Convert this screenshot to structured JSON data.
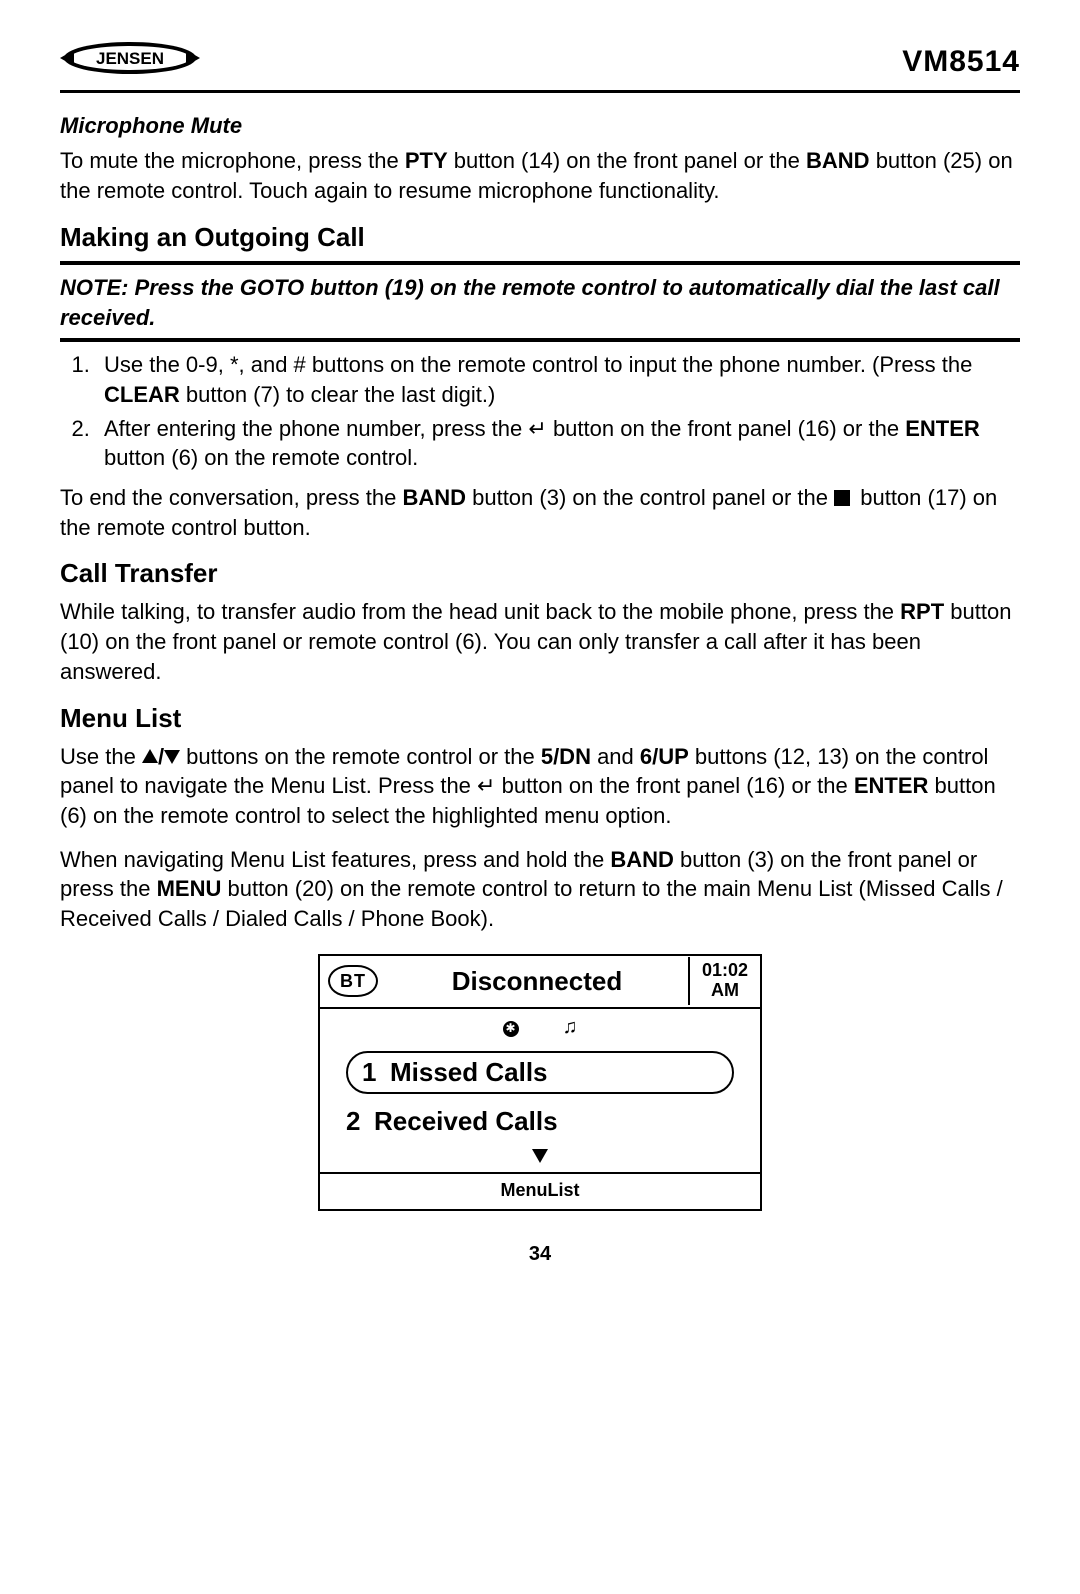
{
  "header": {
    "brand": "JENSEN",
    "model": "VM8514"
  },
  "section_mic_mute": {
    "title": "Microphone Mute",
    "para_parts": {
      "p1": "To mute the microphone, press the ",
      "b1": "PTY",
      "p2": " button (14) on the front panel or the ",
      "b2": "BAND",
      "p3": " button (25) on the remote control. Touch again to resume microphone functionality."
    }
  },
  "section_outgoing": {
    "title": "Making an Outgoing Call",
    "note_parts": {
      "n1": "NOTE: Press the GOTO button (19) on the remote control to automatically dial the last call received."
    },
    "list": {
      "li1": {
        "t1": "Use the 0-9, *, and # buttons on the remote control to input the phone number. (Press the ",
        "b1": "CLEAR",
        "t2": " button (7) to clear the last digit.)"
      },
      "li2": {
        "t1": "After entering the phone number, press the ",
        "g1": "↵",
        "t2": " button on the front panel (16) or the ",
        "b1": "ENTER",
        "t3": " button (6) on the remote control."
      }
    },
    "end_para": {
      "t1": "To end the conversation, press the ",
      "b1": "BAND",
      "t2": " button (3) on the control panel or the ",
      "t3": " button (17) on the remote control button."
    }
  },
  "section_transfer": {
    "title": "Call Transfer",
    "para": {
      "t1": "While talking, to transfer audio from the head unit back to the mobile phone, press the ",
      "b1": "RPT",
      "t2": " button (10) on the front panel or remote control (6). You can only transfer a call after it has been answered."
    }
  },
  "section_menu": {
    "title": "Menu List",
    "para1": {
      "t1": "Use the ",
      "t2": " buttons on the remote control or the ",
      "b1": "5/DN",
      "t3": " and ",
      "b2": "6/UP",
      "t4": " buttons (12, 13) on the control panel to navigate the Menu List. Press the ",
      "g1": "↵",
      "t5": " button on the front panel (16) or the ",
      "b3": "ENTER",
      "t6": " button (6) on the remote control to select the highlighted menu option."
    },
    "para2": {
      "t1": "When navigating Menu List features, press and hold the ",
      "b1": "BAND",
      "t2": " button (3) on the front panel or press the ",
      "b2": "MENU",
      "t3": " button (20) on the remote control to return to the main Menu List (Missed Calls / Received Calls / Dialed Calls / Phone Book)."
    }
  },
  "screen": {
    "bt_label": "BT",
    "status": "Disconnected",
    "time": "01:02",
    "ampm": "AM",
    "item1_num": "1",
    "item1_label": "Missed Calls",
    "item2_num": "2",
    "item2_label": "Received Calls",
    "footer": "MenuList"
  },
  "page_number": "34"
}
